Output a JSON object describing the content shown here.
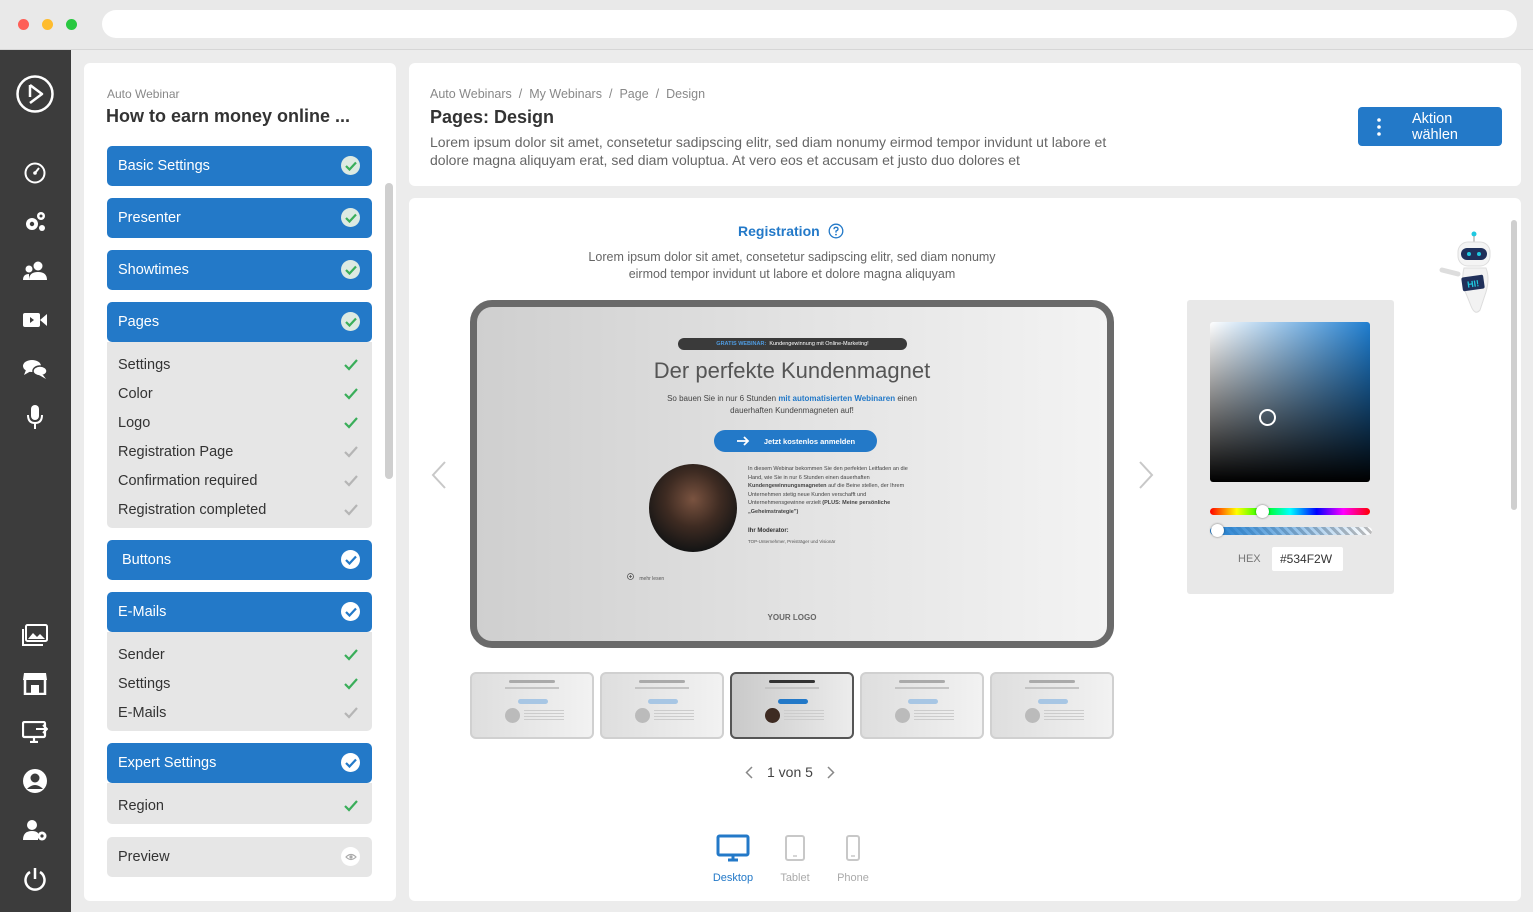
{
  "sidebar": {
    "kicker": "Auto Webinar",
    "title": "How to earn money online ...",
    "sections": [
      {
        "label": "Basic Settings"
      },
      {
        "label": "Presenter"
      },
      {
        "label": "Showtimes"
      },
      {
        "label": "Pages",
        "items": [
          "Settings",
          "Color",
          "Logo",
          "Registration Page",
          "Confirmation required",
          "Registration completed"
        ]
      },
      {
        "label": "Buttons"
      },
      {
        "label": "E-Mails",
        "items": [
          "Sender",
          "Settings",
          "E-Mails"
        ]
      },
      {
        "label": "Expert Settings",
        "items": [
          "Region"
        ]
      },
      {
        "label": "Preview"
      }
    ]
  },
  "header": {
    "breadcrumb": [
      "Auto Webinars",
      "My Webinars",
      "Page",
      "Design"
    ],
    "separator": "/",
    "title": "Pages: Design",
    "description": "Lorem ipsum dolor sit amet, consetetur sadipscing elitr, sed diam nonumy eirmod tempor invidunt ut labore et dolore magna aliquyam erat, sed diam voluptua. At vero eos et accusam et justo duo dolores et",
    "action_label": "Aktion wählen"
  },
  "main": {
    "section_title": "Registration",
    "section_desc": "Lorem ipsum dolor sit amet, consetetur sadipscing elitr, sed diam nonumy eirmod tempor invidunt ut labore et dolore magna aliquyam",
    "preview": {
      "badge_highlight": "GRATIS WEBINAR:",
      "badge_text": "Kundengewinnung mit Online-Marketing!",
      "headline": "Der perfekte Kundenmagnet",
      "sub_a": "So bauen Sie in nur 6 Stunden",
      "sub_b": "mit automatisierten Webinaren",
      "sub_c": "einen dauerhaften Kundenmagneten auf!",
      "cta": "Jetzt kostenlos anmelden",
      "body_a": "In diesem Webinar bekommen Sie den perfekten Leitfaden an die Hand, wie Sie in nur 6 Stunden einen dauerhaften",
      "body_b": "Kundengewinnungsmagneten",
      "body_c": "auf die Beine stellen, der Ihrem Unternehmen stetig neue Kunden verschafft und Unternehmensgewinne erzielt",
      "body_d": "(PLUS: Meine persönliche „Geheimstrategie\")",
      "moderator_label": "Ihr Moderator:",
      "moderator_sub": "TOP-Unternehmer, Preisträger und Visionär",
      "more": "mehr lesen",
      "logo": "YOUR LOGO"
    },
    "pager": {
      "text": "1 von 5"
    },
    "devices": [
      {
        "label": "Desktop",
        "active": true
      },
      {
        "label": "Tablet",
        "active": false
      },
      {
        "label": "Phone",
        "active": false
      }
    ],
    "picker": {
      "hex_label": "HEX",
      "hex_value": "#534F2W",
      "color": "#1f7ed0"
    },
    "bot_text": "HI!"
  },
  "colors": {
    "accent": "#2379c8",
    "rail": "#3c3c3c",
    "check": "#3aae5a"
  }
}
